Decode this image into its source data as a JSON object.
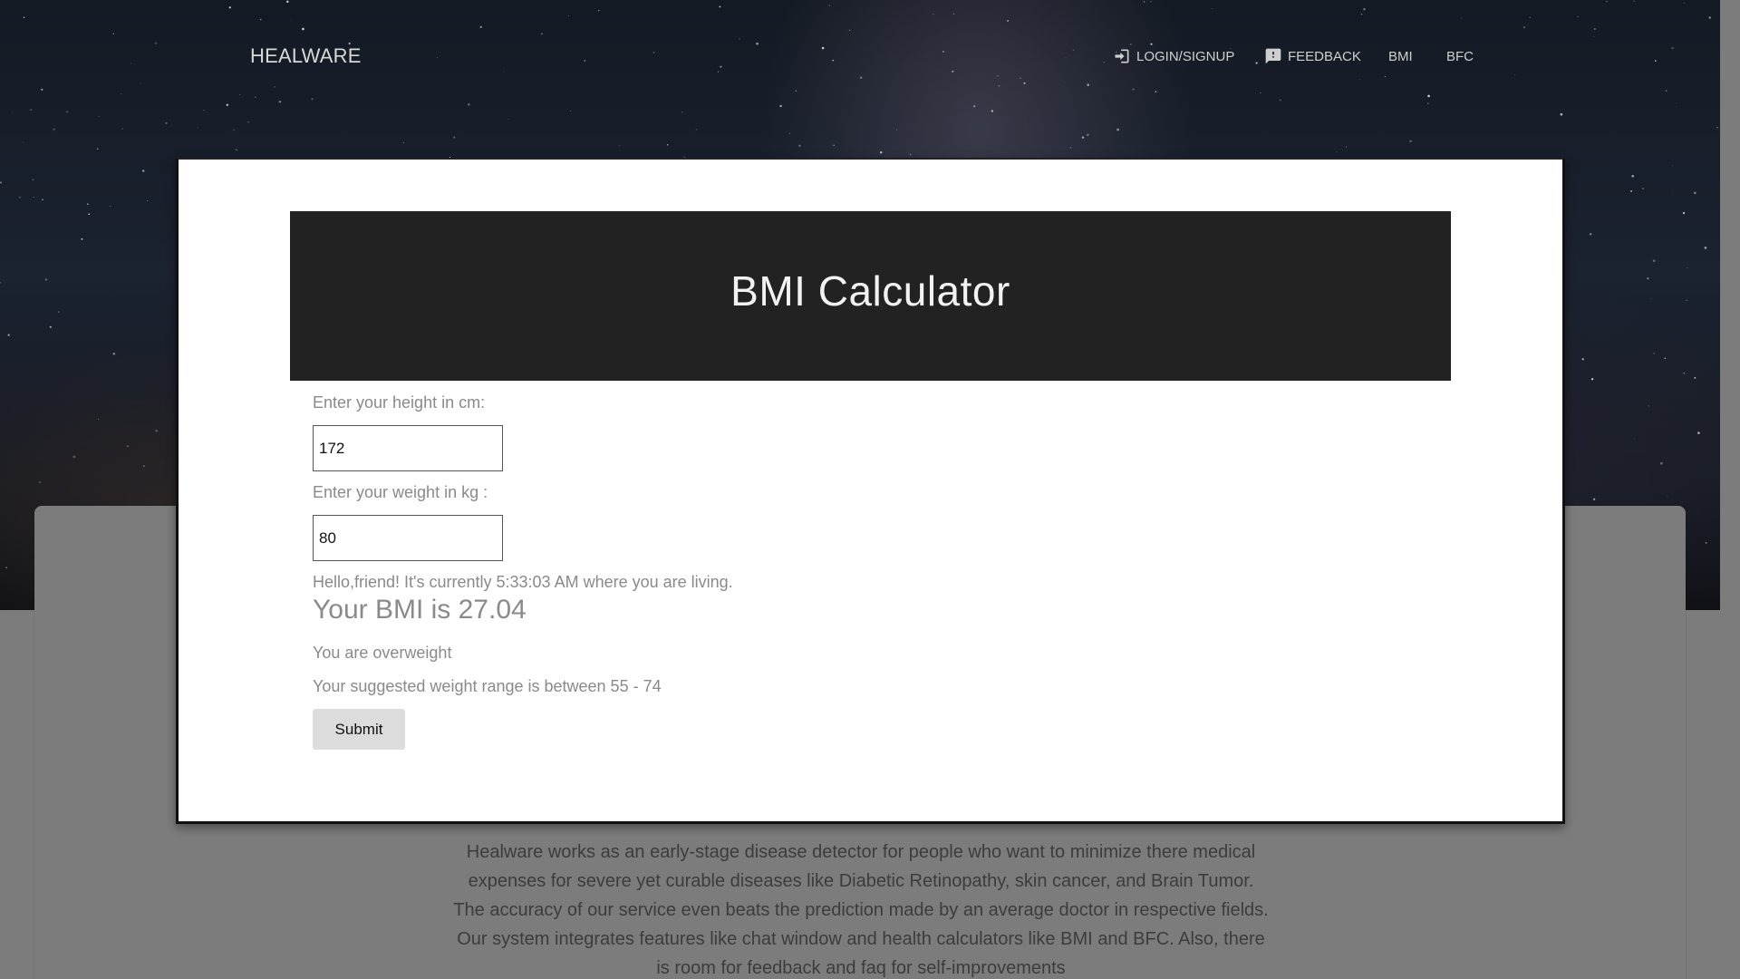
{
  "nav": {
    "brand": "HEALWARE",
    "items": [
      {
        "label": "LOGIN/SIGNUP",
        "icon": "login-icon"
      },
      {
        "label": "FEEDBACK",
        "icon": "feedback-icon"
      },
      {
        "label": "BMI"
      },
      {
        "label": "BFC"
      }
    ]
  },
  "modal": {
    "title": "BMI Calculator",
    "height_label": "Enter your height in cm:",
    "height_value": "172",
    "weight_label": "Enter your weight in kg :",
    "weight_value": "80",
    "greeting": "Hello,friend! It's currently 5:33:03 AM where you are living.",
    "bmi_result": "Your BMI is 27.04",
    "status": "You are overweight",
    "range": "Your suggested weight range is between 55 - 74",
    "submit_label": "Submit"
  },
  "about": {
    "text": "Healware works as an early-stage disease detector for people who want to minimize there medical expenses for severe yet curable diseases like Diabetic Retinopathy, skin cancer, and Brain Tumor. The accuracy of our service even beats the prediction made by an average doctor in respective fields. Our system integrates features like chat window and health calculators like BMI and BFC. Also, there is room for feedback and faq for self-improvements"
  },
  "colors": {
    "modal_header": "#222222",
    "label_text": "#8a8a8a",
    "overlay": "#7c7c7c",
    "submit_bg": "#dcdcdc"
  }
}
